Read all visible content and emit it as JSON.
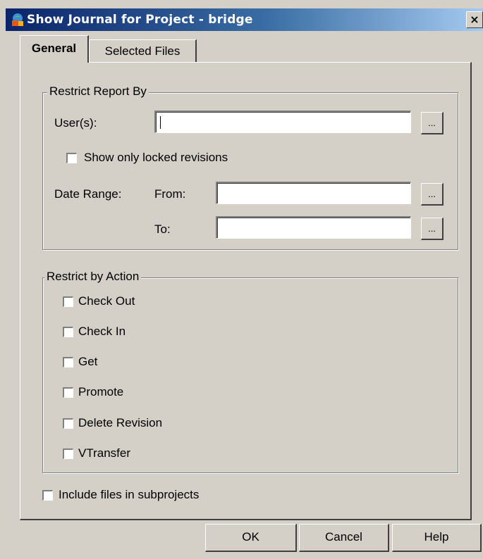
{
  "window": {
    "title": "Show Journal for Project - bridge",
    "close_glyph": "×"
  },
  "tabs": [
    {
      "label": "General",
      "active": true
    },
    {
      "label": "Selected Files",
      "active": false
    }
  ],
  "restrict_report": {
    "legend": "Restrict Report By",
    "users_label": "User(s):",
    "users_value": "",
    "show_locked_label": "Show only locked revisions",
    "show_locked_checked": false,
    "date_range_label": "Date Range:",
    "from_label": "From:",
    "from_value": "",
    "to_label": "To:",
    "to_value": "",
    "browse_label": "..."
  },
  "restrict_action": {
    "legend": "Restrict by Action",
    "options": [
      {
        "label": "Check Out",
        "checked": false
      },
      {
        "label": "Check In",
        "checked": false
      },
      {
        "label": "Get",
        "checked": false
      },
      {
        "label": "Promote",
        "checked": false
      },
      {
        "label": "Delete Revision",
        "checked": false
      },
      {
        "label": "VTransfer",
        "checked": false
      }
    ]
  },
  "include_subprojects": {
    "label": "Include files in subprojects",
    "checked": false
  },
  "buttons": {
    "ok": "OK",
    "cancel": "Cancel",
    "help": "Help"
  },
  "icons": {
    "app": "project-icon",
    "close": "close-icon"
  }
}
